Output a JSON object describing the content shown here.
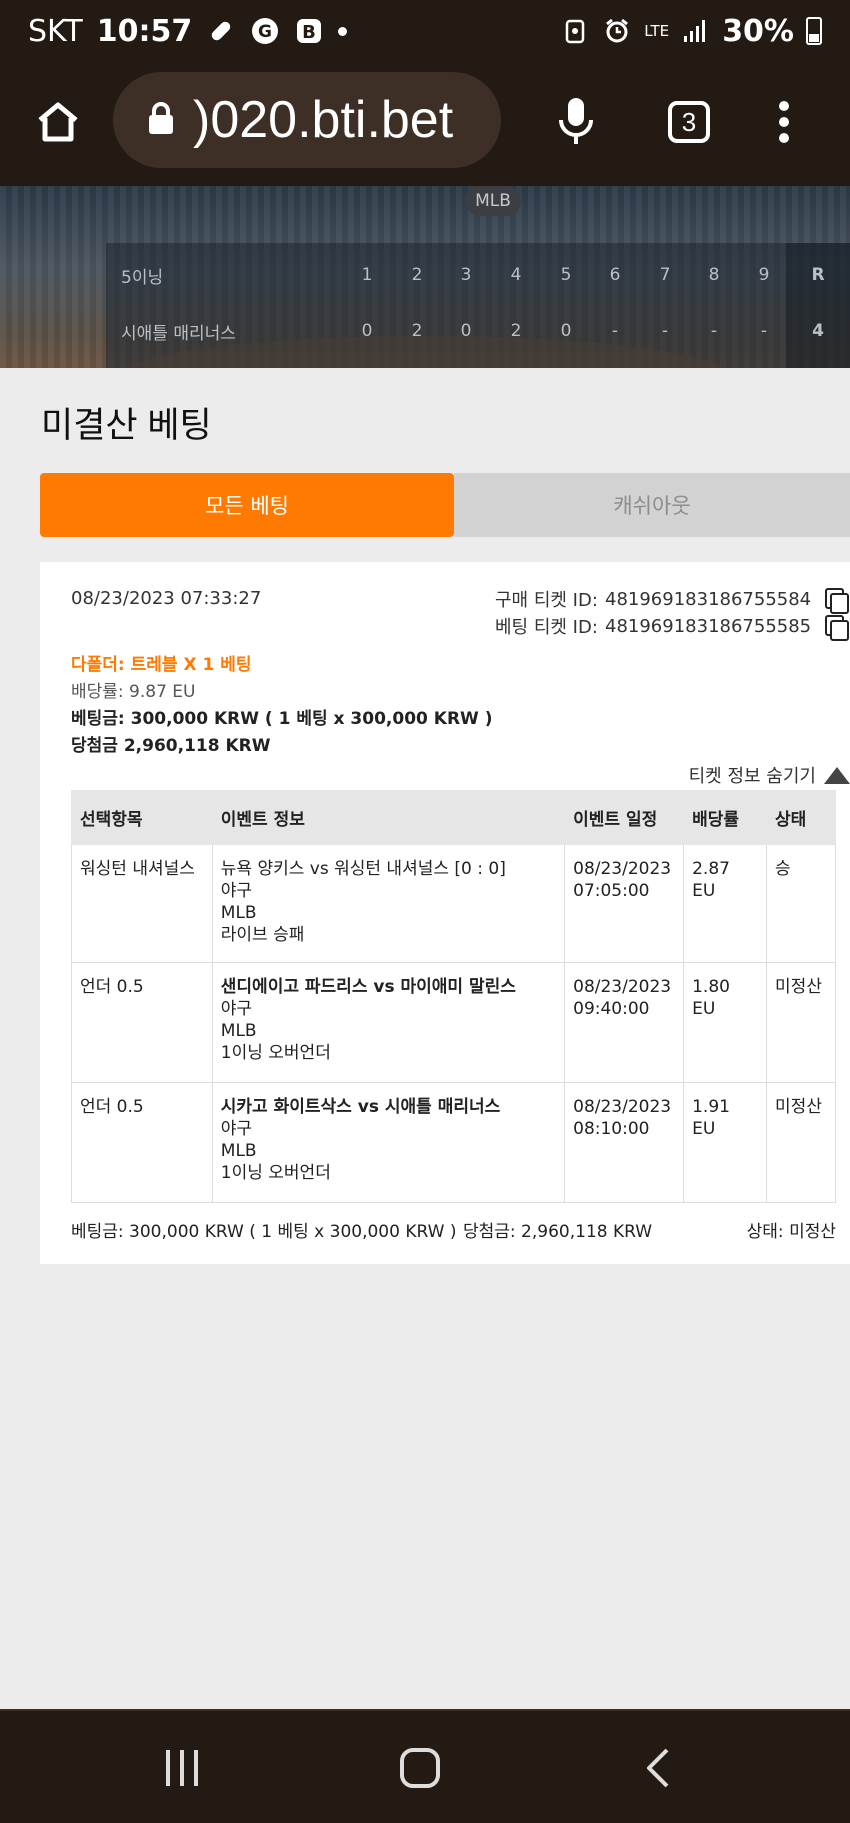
{
  "status_bar": {
    "carrier": "SKT",
    "time": "10:57",
    "network": "LTE",
    "battery": "30%"
  },
  "browser": {
    "url": ")020.bti.bet",
    "tab_count": "3"
  },
  "scoreboard": {
    "league": "MLB",
    "period_label": "5이닝",
    "innings": [
      "1",
      "2",
      "3",
      "4",
      "5",
      "6",
      "7",
      "8",
      "9"
    ],
    "r_label": "R",
    "team_name": "시애틀 매리너스",
    "team_scores": [
      "0",
      "2",
      "0",
      "2",
      "0",
      "-",
      "-",
      "-",
      "-"
    ],
    "team_runs": "4"
  },
  "page": {
    "title": "미결산 베팅",
    "tabs": [
      {
        "label": "모든 베팅",
        "active": true
      },
      {
        "label": "캐쉬아웃",
        "active": false
      }
    ]
  },
  "ticket": {
    "datetime": "08/23/2023 07:33:27",
    "purchase_id_label": "구매 티켓 ID:",
    "purchase_id": "481969183186755584",
    "bet_id_label": "베팅 티켓 ID:",
    "bet_id": "481969183186755585",
    "bet_type": "다폴더: 트레블 X 1 베팅",
    "odds": "배당률: 9.87 EU",
    "stake": "베팅금: 300,000 KRW ( 1 베팅 x 300,000 KRW )",
    "winnings": "당첨금 2,960,118 KRW",
    "hide_info": "티켓 정보 숨기기",
    "columns": [
      "선택항목",
      "이벤트 정보",
      "이벤트 일정",
      "배당률",
      "상태"
    ],
    "rows": [
      {
        "selection": "워싱턴 내셔널스",
        "event": "뉴욕 양키스 vs 워싱턴 내셔널스 [0 : 0]",
        "sport": "야구",
        "league": "MLB",
        "market": "라이브 승패",
        "date": "08/23/2023",
        "time": "07:05:00",
        "odds": "2.87 EU",
        "status": "승"
      },
      {
        "selection": "언더 0.5",
        "event": "샌디에이고 파드리스 vs 마이애미 말린스",
        "sport": "야구",
        "league": "MLB",
        "market": "1이닝 오버언더",
        "date": "08/23/2023",
        "time": "09:40:00",
        "odds": "1.80 EU",
        "status": "미정산"
      },
      {
        "selection": "언더 0.5",
        "event": "시카고 화이트삭스 vs 시애틀 매리너스",
        "sport": "야구",
        "league": "MLB",
        "market": "1이닝 오버언더",
        "date": "08/23/2023",
        "time": "08:10:00",
        "odds": "1.91 EU",
        "status": "미정산"
      }
    ],
    "footer_stake": "베팅금: 300,000 KRW ( 1 베팅 x 300,000 KRW )",
    "footer_payout": "당첨금: 2,960,118 KRW",
    "footer_status": "상태: 미정산"
  },
  "colors": {
    "accent": "#ff7a00",
    "chrome": "#231a14"
  }
}
